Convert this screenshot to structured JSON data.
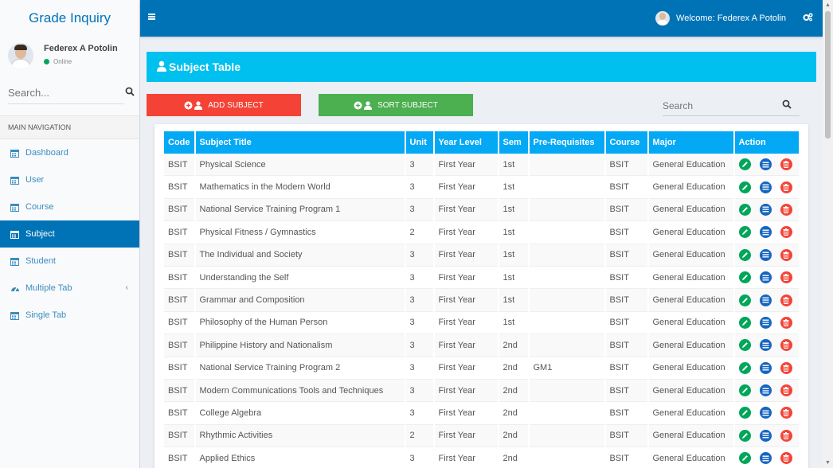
{
  "sidebar": {
    "brand": "Grade Inquiry",
    "user_name": "Federex A Potolin",
    "user_status": "Online",
    "search_placeholder": "Search...",
    "nav_header": "MAIN NAVIGATION",
    "items": [
      {
        "label": "Dashboard",
        "icon": "calendar-icon"
      },
      {
        "label": "User",
        "icon": "calendar-icon"
      },
      {
        "label": "Course",
        "icon": "calendar-icon"
      },
      {
        "label": "Subject",
        "icon": "calendar-icon",
        "active": true
      },
      {
        "label": "Student",
        "icon": "calendar-icon"
      },
      {
        "label": "Multiple Tab",
        "icon": "dashboard-icon"
      },
      {
        "label": "Single Tab",
        "icon": "calendar-icon"
      }
    ]
  },
  "header": {
    "welcome": "Welcome: Federex A Potolin"
  },
  "panel": {
    "title": "Subject Table",
    "add_label": "ADD SUBJECT",
    "sort_label": "SORT SUBJECT",
    "search_placeholder": "Search"
  },
  "colors": {
    "primary": "#0073b7",
    "title_bar": "#00c0ef",
    "table_header": "#03a9f4",
    "add": "#f44336",
    "sort": "#4caf50",
    "edit": "#00a65a",
    "view": "#1565c0",
    "delete": "#f44336"
  },
  "table": {
    "headers": [
      "Code",
      "Subject Title",
      "Unit",
      "Year Level",
      "Sem",
      "Pre-Requisites",
      "Course",
      "Major",
      "Action"
    ],
    "rows": [
      [
        "BSIT",
        "Physical Science",
        "3",
        "First Year",
        "1st",
        "",
        "BSIT",
        "General Education"
      ],
      [
        "BSIT",
        "Mathematics in the Modern World",
        "3",
        "First Year",
        "1st",
        "",
        "BSIT",
        "General Education"
      ],
      [
        "BSIT",
        "National Service Training Program 1",
        "3",
        "First Year",
        "1st",
        "",
        "BSIT",
        "General Education"
      ],
      [
        "BSIT",
        "Physical Fitness / Gymnastics",
        "2",
        "First Year",
        "1st",
        "",
        "BSIT",
        "General Education"
      ],
      [
        "BSIT",
        "The Individual and Society",
        "3",
        "First Year",
        "1st",
        "",
        "BSIT",
        "General Education"
      ],
      [
        "BSIT",
        "Understanding the Self",
        "3",
        "First Year",
        "1st",
        "",
        "BSIT",
        "General Education"
      ],
      [
        "BSIT",
        "Grammar and Composition",
        "3",
        "First Year",
        "1st",
        "",
        "BSIT",
        "General Education"
      ],
      [
        "BSIT",
        "Philosophy of the Human Person",
        "3",
        "First Year",
        "1st",
        "",
        "BSIT",
        "General Education"
      ],
      [
        "BSIT",
        "Philippine History and Nationalism",
        "3",
        "First Year",
        "2nd",
        "",
        "BSIT",
        "General Education"
      ],
      [
        "BSIT",
        "National Service Training Program 2",
        "3",
        "First Year",
        "2nd",
        "GM1",
        "BSIT",
        "General Education"
      ],
      [
        "BSIT",
        "Modern Communications Tools and Techniques",
        "3",
        "First Year",
        "2nd",
        "",
        "BSIT",
        "General Education"
      ],
      [
        "BSIT",
        "College Algebra",
        "3",
        "First Year",
        "2nd",
        "",
        "BSIT",
        "General Education"
      ],
      [
        "BSIT",
        "Rhythmic Activities",
        "2",
        "First Year",
        "2nd",
        "",
        "BSIT",
        "General Education"
      ],
      [
        "BSIT",
        "Applied Ethics",
        "3",
        "First Year",
        "2nd",
        "",
        "BSIT",
        "General Education"
      ]
    ]
  }
}
